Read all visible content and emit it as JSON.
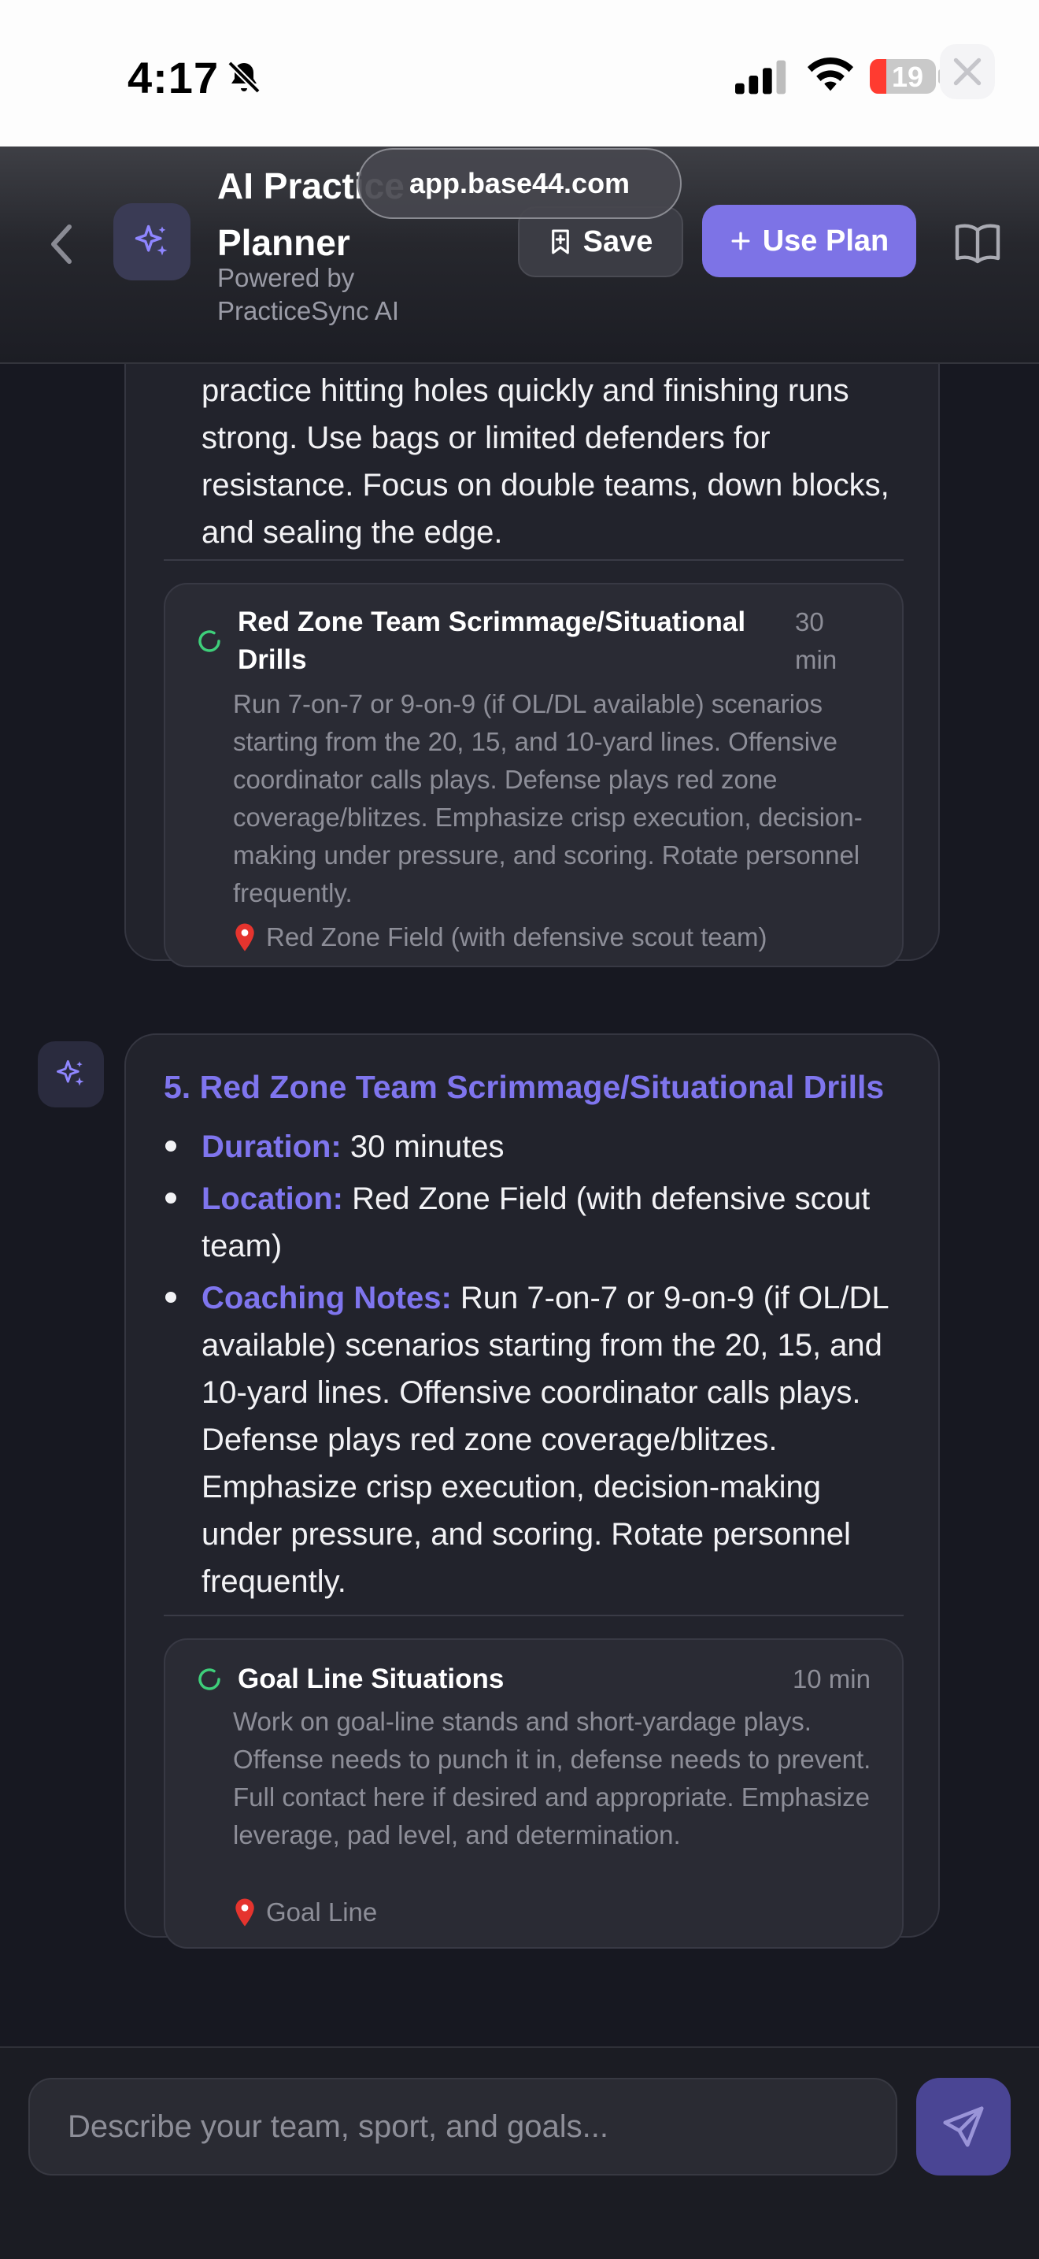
{
  "status_bar": {
    "time": "4:17",
    "battery_level": "19"
  },
  "header": {
    "title": "AI Practice Planner",
    "subtitle": "Powered by PracticeSync AI",
    "url": "app.base44.com",
    "save_label": "Save",
    "use_plan_label": "Use Plan"
  },
  "message_previous": {
    "body_tail": "practice hitting holes quickly and finishing runs strong. Use bags or limited defenders for resistance. Focus on double teams, down blocks, and sealing the edge.",
    "next_drill": {
      "title": "Red Zone Team Scrimmage/Situational Drills",
      "duration": "30 min",
      "description": "Run 7-on-7 or 9-on-9 (if OL/DL available) scenarios starting from the 20, 15, and 10-yard lines. Offensive coordinator calls plays. Defense plays red zone coverage/blitzes. Emphasize crisp execution, decision-making under pressure, and scoring. Rotate personnel frequently.",
      "location": "Red Zone Field (with defensive scout team)"
    }
  },
  "message_current": {
    "section_title": "5. Red Zone Team Scrimmage/Situational Drills",
    "items": [
      {
        "label": "Duration:",
        "value": "30 minutes"
      },
      {
        "label": "Location:",
        "value": "Red Zone Field (with defensive scout team)"
      },
      {
        "label": "Coaching Notes:",
        "value": "Run 7-on-7 or 9-on-9 (if OL/DL available) scenarios starting from the 20, 15, and 10-yard lines. Offensive coordinator calls plays. Defense plays red zone coverage/blitzes. Emphasize crisp execution, decision-making under pressure, and scoring. Rotate personnel frequently."
      }
    ],
    "next_drill": {
      "title": "Goal Line Situations",
      "duration": "10 min",
      "description": "Work on goal-line stands and short-yardage plays. Offense needs to punch it in, defense needs to prevent. Full contact here if desired and appropriate. Emphasize leverage, pad level, and determination.",
      "location": "Goal Line"
    }
  },
  "composer": {
    "placeholder": "Describe your team, sport, and goals..."
  },
  "colors": {
    "accent": "#7f75ee",
    "button_primary": "#7d73e6",
    "background": "#171821",
    "card": "#22232c",
    "spinner": "#3ecf7a",
    "battery_low": "#ff3b30"
  },
  "icons": {
    "bell": "bell-slash-icon",
    "back": "chevron-left-icon",
    "logo": "sparkles-icon",
    "save": "bookmark-plus-icon",
    "use_plan": "plus-icon",
    "book": "book-open-icon",
    "spinner": "loading-spinner-icon",
    "location": "map-pin-icon",
    "send": "send-icon"
  }
}
